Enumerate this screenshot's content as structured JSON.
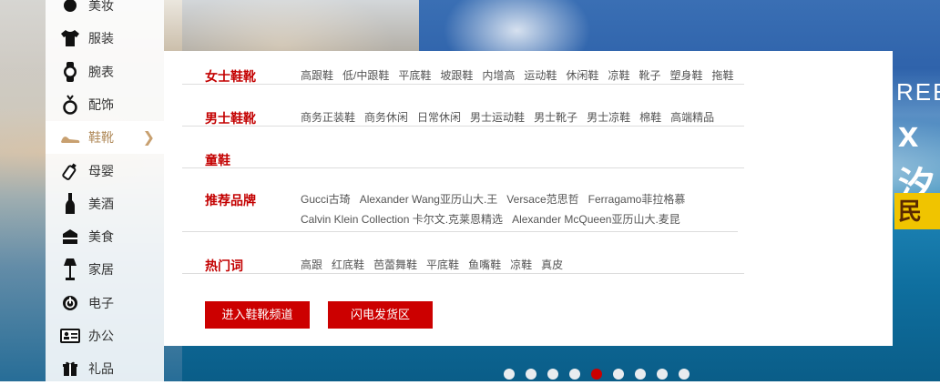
{
  "sidebar": {
    "items": [
      {
        "label": "美妆",
        "icon": "lipstick-icon"
      },
      {
        "label": "服装",
        "icon": "tshirt-icon"
      },
      {
        "label": "腕表",
        "icon": "watch-icon"
      },
      {
        "label": "配饰",
        "icon": "ring-icon"
      },
      {
        "label": "鞋靴",
        "icon": "shoe-icon",
        "active": true
      },
      {
        "label": "母婴",
        "icon": "baby-bottle-icon"
      },
      {
        "label": "美酒",
        "icon": "wine-bottle-icon"
      },
      {
        "label": "美食",
        "icon": "cake-icon"
      },
      {
        "label": "家居",
        "icon": "lamp-icon"
      },
      {
        "label": "电子",
        "icon": "power-icon"
      },
      {
        "label": "办公",
        "icon": "id-card-icon"
      },
      {
        "label": "礼品",
        "icon": "gift-icon"
      }
    ]
  },
  "panel": {
    "rows": [
      {
        "title": "女士鞋靴",
        "lines": [
          [
            "高跟鞋",
            "低/中跟鞋",
            "平底鞋",
            "坡跟鞋",
            "内增高",
            "运动鞋",
            "休闲鞋",
            "凉鞋",
            "靴子",
            "塑身鞋",
            "拖鞋"
          ]
        ]
      },
      {
        "title": "男士鞋靴",
        "lines": [
          [
            "商务正装鞋",
            "商务休闲",
            "日常休闲",
            "男士运动鞋",
            "男士靴子",
            "男士凉鞋",
            "棉鞋",
            "高端精品"
          ]
        ]
      },
      {
        "title": "童鞋",
        "lines": []
      },
      {
        "title": "推荐品牌",
        "lines": [
          [
            "Gucci古琦",
            "Alexander Wang亚历山大.王",
            "Versace范思哲",
            "Ferragamo菲拉格慕"
          ],
          [
            "Calvin Klein Collection 卡尔文.克莱恩精选",
            "Alexander McQueen亚历山大.麦昆"
          ]
        ]
      },
      {
        "title": "热门词",
        "lines": [
          [
            "高跟",
            "红底鞋",
            "芭蕾舞鞋",
            "平底鞋",
            "鱼嘴鞋",
            "凉鞋",
            "真皮"
          ]
        ]
      }
    ],
    "buttons": {
      "enter_channel": "进入鞋靴频道",
      "flash_delivery": "闪电发货区"
    }
  },
  "banner": {
    "text_fragment_1": "REEC",
    "text_fragment_2": "x汐",
    "text_fragment_3": "民"
  },
  "carousel": {
    "total": 9,
    "active_index": 4
  },
  "colors": {
    "accent_red": "#cc0000",
    "title_red": "#c30000",
    "active_tan": "#b08a5a"
  }
}
